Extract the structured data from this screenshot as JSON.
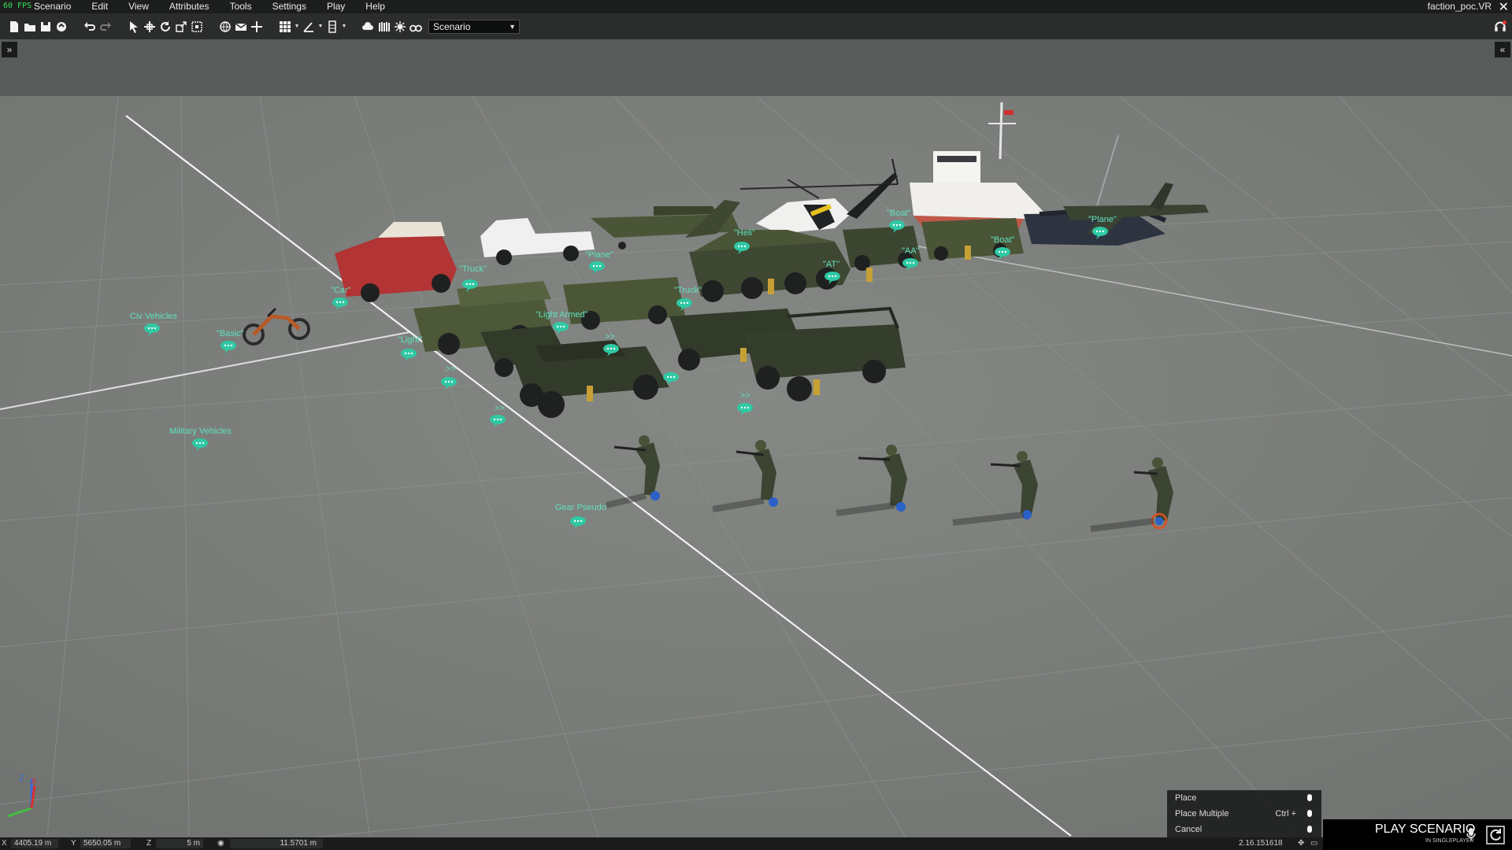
{
  "menubar": {
    "fps": "60 FPS",
    "items": [
      "Scenario",
      "Edit",
      "View",
      "Attributes",
      "Tools",
      "Settings",
      "Play",
      "Help"
    ],
    "scenario_title": "faction_poc.VR",
    "close_icon": "close-icon"
  },
  "toolbar": {
    "scenario_dropdown": "Scenario",
    "icons": [
      "new-file-icon",
      "open-folder-icon",
      "save-icon",
      "publish-icon",
      "undo-icon",
      "redo-icon",
      "select-icon",
      "translate-icon",
      "rotate-icon",
      "scale-icon",
      "area-select-icon",
      "globe-icon",
      "mail-icon",
      "crosshair-icon",
      "grid-icon",
      "angle-icon",
      "vertical-snap-icon",
      "weather-icon",
      "terrain-icon",
      "sun-icon",
      "binoculars-icon"
    ]
  },
  "panels": {
    "left_collapse": "»",
    "right_collapse": "«"
  },
  "viewport": {
    "labels": {
      "civ_vehicles": "Civ Vehicles",
      "basic": "\"Basic\"",
      "car": "\"Car\"",
      "truck1": "\"Truck\"",
      "plane1": "\"Plane\"",
      "light": "\"Light\"",
      "light_armed": "\"Light Armed\"",
      "truck2": "\"Truck\"",
      "heli": "\"Heli\"",
      "at": "\"AT\"",
      "aa": "\"AA\"",
      "boat1": "\"Boat\"",
      "boat2": "\"Boat\"",
      "plane2": "\"Plane\"",
      "arrows1": ">>",
      "arrows2": ">>",
      "arrows3": ">>",
      "arrows4": ">>",
      "military_vehicles": "Military Vehicles",
      "gear_pseudo": "Gear Pseudo"
    },
    "axis": {
      "z": "Z",
      "x": "X"
    }
  },
  "context_menu": {
    "items": [
      {
        "label": "Place",
        "shortcut": ""
      },
      {
        "label": "Place Multiple",
        "shortcut": "Ctrl +"
      },
      {
        "label": "Cancel",
        "shortcut": ""
      }
    ]
  },
  "play_button": {
    "label": "PLAY SCENARIO",
    "sub": "IN SINGLEPLAYER"
  },
  "statusbar": {
    "x": "4405.19 m",
    "y": "5650.05 m",
    "z": "5 m",
    "camera_distance": "11.5701 m",
    "version": "2.16.151618"
  }
}
